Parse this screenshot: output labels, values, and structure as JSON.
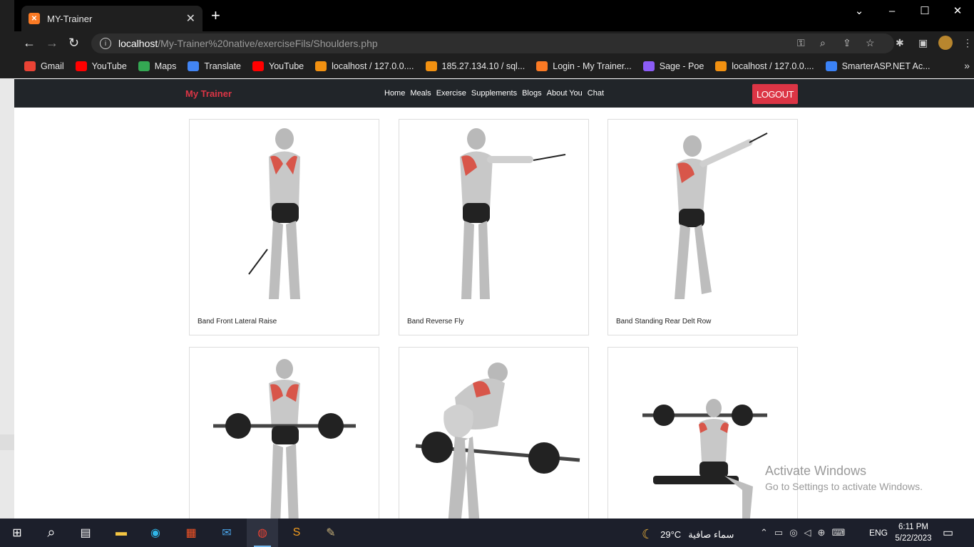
{
  "browser": {
    "tab_title": "MY-Trainer",
    "tab_favicon": "xampp-icon",
    "url_host": "localhost",
    "url_path": "/My-Trainer%20native/exerciseFils/Shoulders.php",
    "bookmarks": [
      {
        "label": "Gmail",
        "icon": "gmail-icon",
        "color": "#ea4335"
      },
      {
        "label": "YouTube",
        "icon": "youtube-icon",
        "color": "#ff0000"
      },
      {
        "label": "Maps",
        "icon": "maps-icon",
        "color": "#34a853"
      },
      {
        "label": "Translate",
        "icon": "translate-icon",
        "color": "#4285f4"
      },
      {
        "label": "YouTube",
        "icon": "youtube-icon",
        "color": "#ff0000"
      },
      {
        "label": "localhost / 127.0.0....",
        "icon": "phpmyadmin-icon",
        "color": "#f29111"
      },
      {
        "label": "185.27.134.10 / sql...",
        "icon": "phpmyadmin-icon",
        "color": "#f29111"
      },
      {
        "label": "Login - My Trainer...",
        "icon": "xampp-icon",
        "color": "#fb7a24"
      },
      {
        "label": "Sage - Poe",
        "icon": "poe-icon",
        "color": "#8b5cf6"
      },
      {
        "label": "localhost / 127.0.0....",
        "icon": "phpmyadmin-icon",
        "color": "#f29111"
      },
      {
        "label": "SmarterASP.NET Ac...",
        "icon": "smarterasp-icon",
        "color": "#3b82f6"
      }
    ]
  },
  "site": {
    "brand": "My Trainer",
    "menu": [
      "Home",
      "Meals",
      "Exercise",
      "Supplements",
      "Blogs",
      "About You",
      "Chat"
    ],
    "logout": "LOGOUT"
  },
  "exercises": [
    {
      "name": "Band Front Lateral Raise"
    },
    {
      "name": "Band Reverse Fly"
    },
    {
      "name": "Band Standing Rear Delt Row"
    },
    {
      "name": ""
    },
    {
      "name": ""
    },
    {
      "name": ""
    }
  ],
  "watermark": {
    "line1": "Activate Windows",
    "line2": "Go to Settings to activate Windows."
  },
  "taskbar": {
    "weather_temp": "29°C",
    "weather_text": "سماء صافية",
    "language": "ENG",
    "time": "6:11 PM",
    "date": "5/22/2023"
  }
}
